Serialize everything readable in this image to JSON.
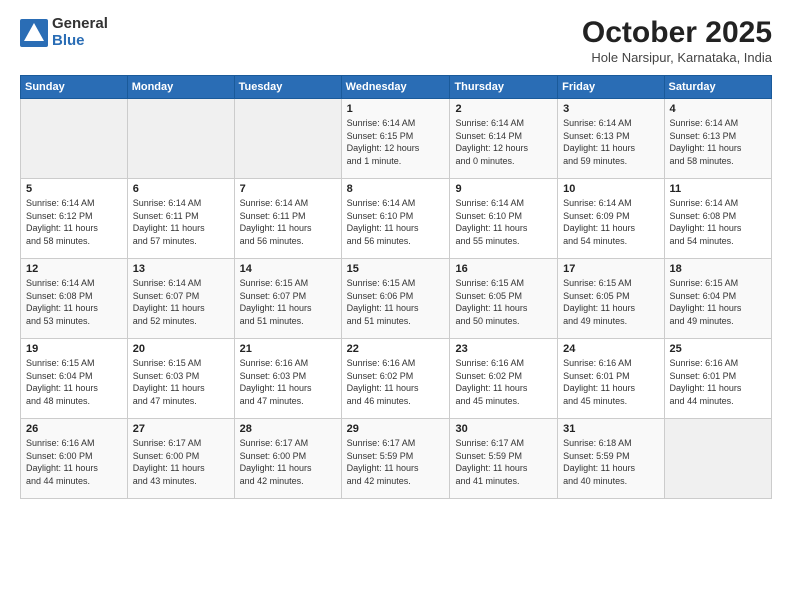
{
  "header": {
    "logo_general": "General",
    "logo_blue": "Blue",
    "month_title": "October 2025",
    "location": "Hole Narsipur, Karnataka, India"
  },
  "days_of_week": [
    "Sunday",
    "Monday",
    "Tuesday",
    "Wednesday",
    "Thursday",
    "Friday",
    "Saturday"
  ],
  "weeks": [
    [
      {
        "day": "",
        "info": ""
      },
      {
        "day": "",
        "info": ""
      },
      {
        "day": "",
        "info": ""
      },
      {
        "day": "1",
        "info": "Sunrise: 6:14 AM\nSunset: 6:15 PM\nDaylight: 12 hours\nand 1 minute."
      },
      {
        "day": "2",
        "info": "Sunrise: 6:14 AM\nSunset: 6:14 PM\nDaylight: 12 hours\nand 0 minutes."
      },
      {
        "day": "3",
        "info": "Sunrise: 6:14 AM\nSunset: 6:13 PM\nDaylight: 11 hours\nand 59 minutes."
      },
      {
        "day": "4",
        "info": "Sunrise: 6:14 AM\nSunset: 6:13 PM\nDaylight: 11 hours\nand 58 minutes."
      }
    ],
    [
      {
        "day": "5",
        "info": "Sunrise: 6:14 AM\nSunset: 6:12 PM\nDaylight: 11 hours\nand 58 minutes."
      },
      {
        "day": "6",
        "info": "Sunrise: 6:14 AM\nSunset: 6:11 PM\nDaylight: 11 hours\nand 57 minutes."
      },
      {
        "day": "7",
        "info": "Sunrise: 6:14 AM\nSunset: 6:11 PM\nDaylight: 11 hours\nand 56 minutes."
      },
      {
        "day": "8",
        "info": "Sunrise: 6:14 AM\nSunset: 6:10 PM\nDaylight: 11 hours\nand 56 minutes."
      },
      {
        "day": "9",
        "info": "Sunrise: 6:14 AM\nSunset: 6:10 PM\nDaylight: 11 hours\nand 55 minutes."
      },
      {
        "day": "10",
        "info": "Sunrise: 6:14 AM\nSunset: 6:09 PM\nDaylight: 11 hours\nand 54 minutes."
      },
      {
        "day": "11",
        "info": "Sunrise: 6:14 AM\nSunset: 6:08 PM\nDaylight: 11 hours\nand 54 minutes."
      }
    ],
    [
      {
        "day": "12",
        "info": "Sunrise: 6:14 AM\nSunset: 6:08 PM\nDaylight: 11 hours\nand 53 minutes."
      },
      {
        "day": "13",
        "info": "Sunrise: 6:14 AM\nSunset: 6:07 PM\nDaylight: 11 hours\nand 52 minutes."
      },
      {
        "day": "14",
        "info": "Sunrise: 6:15 AM\nSunset: 6:07 PM\nDaylight: 11 hours\nand 51 minutes."
      },
      {
        "day": "15",
        "info": "Sunrise: 6:15 AM\nSunset: 6:06 PM\nDaylight: 11 hours\nand 51 minutes."
      },
      {
        "day": "16",
        "info": "Sunrise: 6:15 AM\nSunset: 6:05 PM\nDaylight: 11 hours\nand 50 minutes."
      },
      {
        "day": "17",
        "info": "Sunrise: 6:15 AM\nSunset: 6:05 PM\nDaylight: 11 hours\nand 49 minutes."
      },
      {
        "day": "18",
        "info": "Sunrise: 6:15 AM\nSunset: 6:04 PM\nDaylight: 11 hours\nand 49 minutes."
      }
    ],
    [
      {
        "day": "19",
        "info": "Sunrise: 6:15 AM\nSunset: 6:04 PM\nDaylight: 11 hours\nand 48 minutes."
      },
      {
        "day": "20",
        "info": "Sunrise: 6:15 AM\nSunset: 6:03 PM\nDaylight: 11 hours\nand 47 minutes."
      },
      {
        "day": "21",
        "info": "Sunrise: 6:16 AM\nSunset: 6:03 PM\nDaylight: 11 hours\nand 47 minutes."
      },
      {
        "day": "22",
        "info": "Sunrise: 6:16 AM\nSunset: 6:02 PM\nDaylight: 11 hours\nand 46 minutes."
      },
      {
        "day": "23",
        "info": "Sunrise: 6:16 AM\nSunset: 6:02 PM\nDaylight: 11 hours\nand 45 minutes."
      },
      {
        "day": "24",
        "info": "Sunrise: 6:16 AM\nSunset: 6:01 PM\nDaylight: 11 hours\nand 45 minutes."
      },
      {
        "day": "25",
        "info": "Sunrise: 6:16 AM\nSunset: 6:01 PM\nDaylight: 11 hours\nand 44 minutes."
      }
    ],
    [
      {
        "day": "26",
        "info": "Sunrise: 6:16 AM\nSunset: 6:00 PM\nDaylight: 11 hours\nand 44 minutes."
      },
      {
        "day": "27",
        "info": "Sunrise: 6:17 AM\nSunset: 6:00 PM\nDaylight: 11 hours\nand 43 minutes."
      },
      {
        "day": "28",
        "info": "Sunrise: 6:17 AM\nSunset: 6:00 PM\nDaylight: 11 hours\nand 42 minutes."
      },
      {
        "day": "29",
        "info": "Sunrise: 6:17 AM\nSunset: 5:59 PM\nDaylight: 11 hours\nand 42 minutes."
      },
      {
        "day": "30",
        "info": "Sunrise: 6:17 AM\nSunset: 5:59 PM\nDaylight: 11 hours\nand 41 minutes."
      },
      {
        "day": "31",
        "info": "Sunrise: 6:18 AM\nSunset: 5:59 PM\nDaylight: 11 hours\nand 40 minutes."
      },
      {
        "day": "",
        "info": ""
      }
    ]
  ]
}
